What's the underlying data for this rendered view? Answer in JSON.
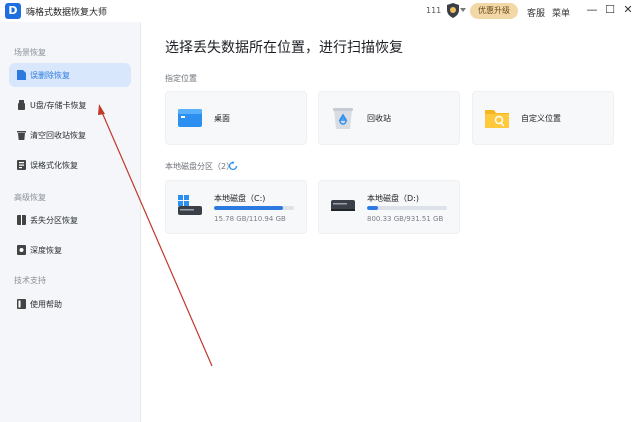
{
  "app": {
    "title": "嗨格式数据恢复大师",
    "logo_letter": "D",
    "count": "111",
    "upgrade_label": "优惠升级",
    "service_label": "客服",
    "menu_label": "菜单",
    "minimize": "—",
    "maximize": "☐",
    "close": "✕"
  },
  "sidebar": {
    "sections": [
      {
        "title": "场景恢复",
        "items": [
          {
            "label": "误删除恢复",
            "icon": "file-icon",
            "active": true
          },
          {
            "label": "U盘/存储卡恢复",
            "icon": "usb-icon"
          },
          {
            "label": "清空回收站恢复",
            "icon": "recycle-bin-icon"
          },
          {
            "label": "误格式化恢复",
            "icon": "format-icon"
          }
        ]
      },
      {
        "title": "高级恢复",
        "items": [
          {
            "label": "丢失分区恢复",
            "icon": "partition-icon"
          },
          {
            "label": "深度恢复",
            "icon": "deep-scan-icon"
          }
        ]
      },
      {
        "title": "技术支持",
        "items": [
          {
            "label": "使用帮助",
            "icon": "help-book-icon"
          }
        ]
      }
    ]
  },
  "main": {
    "title": "选择丢失数据所在位置，进行扫描恢复",
    "locations_title": "指定位置",
    "locations": [
      {
        "label": "桌面",
        "icon": "desktop-icon"
      },
      {
        "label": "回收站",
        "icon": "recycle-bin-icon"
      },
      {
        "label": "自定义位置",
        "icon": "folder-search-icon"
      }
    ],
    "disks_title": "本地磁盘分区（2）",
    "disks": [
      {
        "name": "本地磁盘（C:)",
        "size": "15.78 GB/110.94 GB",
        "usage": 0.86,
        "icon": "windows-drive-icon"
      },
      {
        "name": "本地磁盘（D:)",
        "size": "800.33 GB/931.51 GB",
        "usage": 0.14,
        "icon": "drive-icon"
      }
    ]
  },
  "colors": {
    "accent": "#2d7be0",
    "sidebar_bg": "#f4f6f9",
    "active_bg": "#d8e7fb",
    "upgrade_bg": "#f1d8a6",
    "annotation_arrow": "#c0392b"
  }
}
